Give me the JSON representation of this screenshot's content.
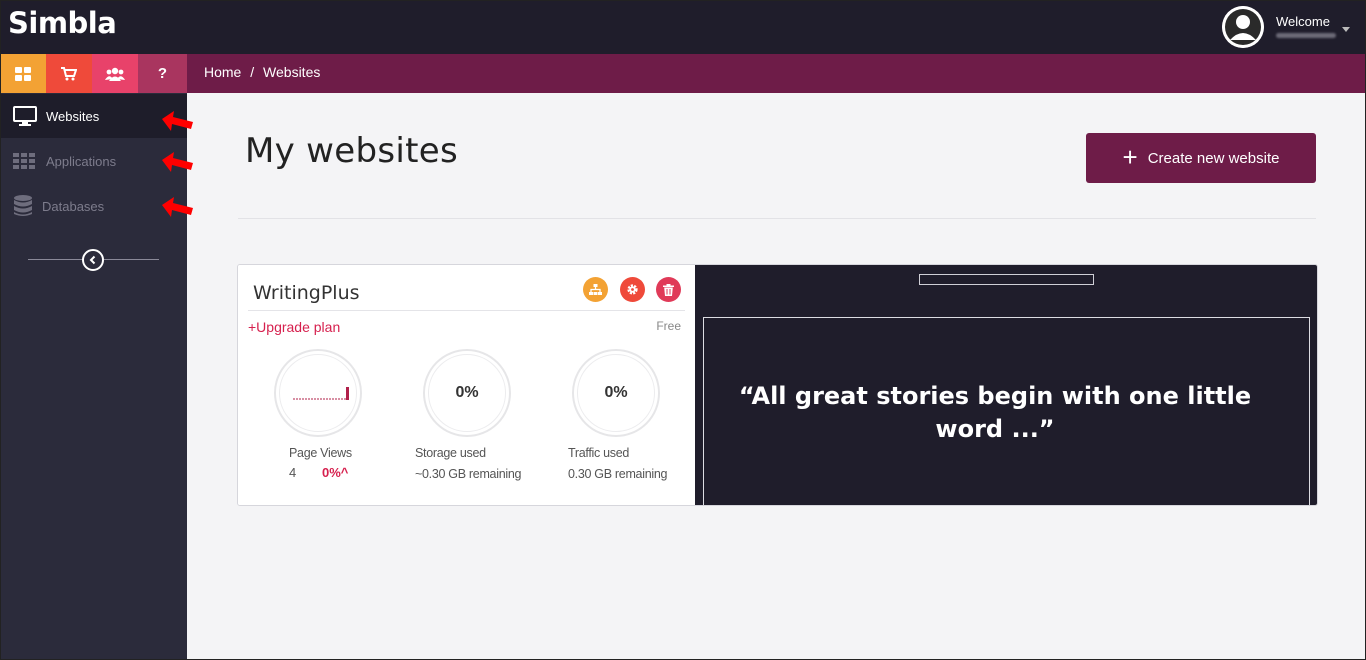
{
  "brand": {
    "logo_text": "Simbla"
  },
  "header": {
    "welcome_label": "Welcome",
    "caret_icon": "caret-down-icon"
  },
  "quickbar": {
    "buttons": [
      {
        "icon": "dashboard-grid-icon",
        "color": "#f3a234"
      },
      {
        "icon": "shopping-cart-icon",
        "color": "#ef4a3a"
      },
      {
        "icon": "users-icon",
        "color": "#e8426a"
      },
      {
        "label": "?",
        "icon": "help-icon",
        "color": "#a9355f"
      }
    ]
  },
  "breadcrumb": {
    "home": "Home",
    "separator": "/",
    "current": "Websites"
  },
  "sidebar": {
    "items": [
      {
        "label": "Websites",
        "icon": "monitor-icon",
        "active": true
      },
      {
        "label": "Applications",
        "icon": "apps-grid-icon",
        "active": false
      },
      {
        "label": "Databases",
        "icon": "database-icon",
        "active": false
      }
    ],
    "collapse_icon": "chevron-left-icon"
  },
  "main": {
    "title": "My websites",
    "create_button": {
      "plus": "+",
      "label": "Create new website"
    }
  },
  "site_card": {
    "name": "WritingPlus",
    "action_icons": [
      "sitemap-icon",
      "gear-icon",
      "trash-icon"
    ],
    "upgrade_label": "+Upgrade plan",
    "plan": "Free",
    "stats": {
      "page_views": {
        "label": "Page Views",
        "count": "4",
        "change": "0%^"
      },
      "storage": {
        "value": "0%",
        "label": "Storage used",
        "remaining": "~0.30 GB remaining"
      },
      "traffic": {
        "value": "0%",
        "label": "Traffic used",
        "remaining": "0.30 GB remaining"
      }
    },
    "preview_quote": "“All great stories begin with one little word ...”"
  },
  "colors": {
    "header_bg": "#1f1d2b",
    "subbar_bg": "#6e1c48",
    "sidebar_bg": "#2b2b3b",
    "accent_red": "#d6204e",
    "annotation_arrow": "#ff0000"
  }
}
